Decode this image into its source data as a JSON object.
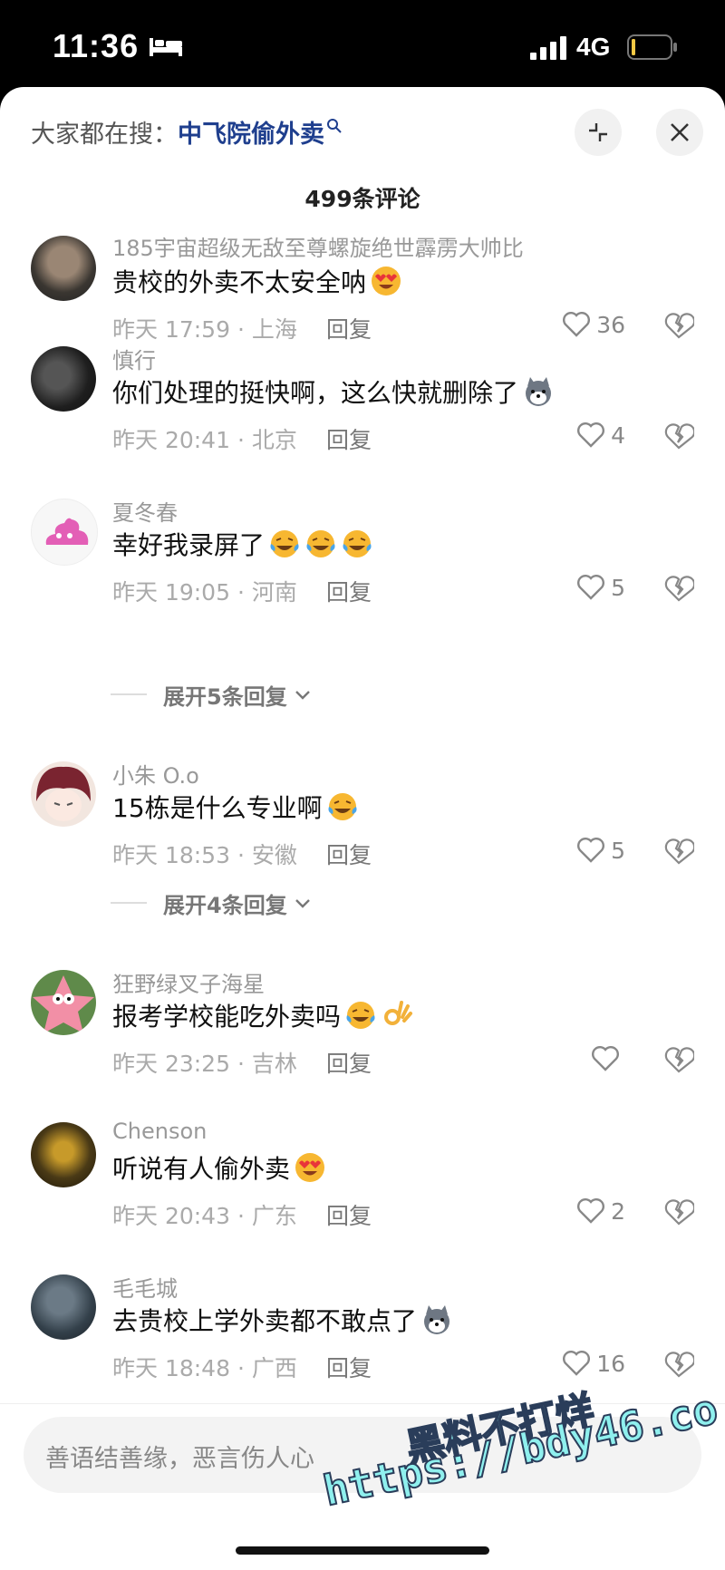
{
  "status_bar": {
    "time": "11:36",
    "network": "4G"
  },
  "header": {
    "search_prefix": "大家都在搜：",
    "search_term": "中飞院偷外卖",
    "comment_count": "499条评论"
  },
  "comments": [
    {
      "user": "185宇宙超级无敌至尊螺旋绝世霹雳大帅比",
      "text": "贵校的外卖不太安全呐",
      "emoji": "heart-eyes-emoji",
      "meta": "昨天 17:59 · 上海",
      "reply": "回复",
      "likes": "36"
    },
    {
      "user": "慎行",
      "text": "你们处理的挺快啊，这么快就删除了",
      "emoji": "husky-emoji",
      "meta": "昨天 20:41 · 北京",
      "reply": "回复",
      "likes": "4"
    },
    {
      "user": "夏冬春",
      "text": "幸好我录屏了",
      "emoji": "laughing-tears-emoji",
      "meta": "昨天 19:05 · 河南",
      "reply": "回复",
      "likes": "5",
      "expand": "展开5条回复"
    },
    {
      "user": "小朱 O.o",
      "text": "15栋是什么专业啊",
      "emoji": "laughing-tears-emoji",
      "meta": "昨天 18:53 · 安徽",
      "reply": "回复",
      "likes": "5",
      "expand": "展开4条回复"
    },
    {
      "user": "狂野绿叉子海星",
      "text": "报考学校能吃外卖吗",
      "emoji": "laughing-tears-emoji",
      "meta": "昨天 23:25 · 吉林",
      "reply": "回复",
      "likes": ""
    },
    {
      "user": "Chenson",
      "text": "听说有人偷外卖",
      "emoji": "heart-eyes-emoji",
      "meta": "昨天 20:43 · 广东",
      "reply": "回复",
      "likes": "2"
    },
    {
      "user": "毛毛城",
      "text": "去贵校上学外卖都不敢点了",
      "emoji": "husky-emoji",
      "meta": "昨天 18:48 · 广西",
      "reply": "回复",
      "likes": "16"
    }
  ],
  "input": {
    "placeholder": "善语结善缘，恶言伤人心"
  },
  "watermark": {
    "line1": "黑料不打烊",
    "line2": "https://bdy46.co"
  },
  "colors": {
    "search_term": "#1f3f8e",
    "watermark": "#8ff0ee"
  }
}
